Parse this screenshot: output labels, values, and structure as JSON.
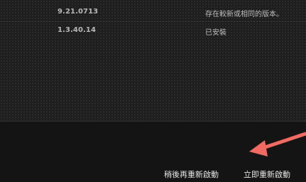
{
  "updates": {
    "rows": [
      {
        "version": "9.21.0713",
        "status": "存在較新或相同的版本。"
      },
      {
        "version": "1.3.40.14",
        "status": "已安裝"
      }
    ]
  },
  "footer": {
    "restart_later_label": "稍後再重新啟動",
    "restart_now_label": "立即重新啟動"
  },
  "annotation": {
    "arrow_color": "#f26b63"
  }
}
